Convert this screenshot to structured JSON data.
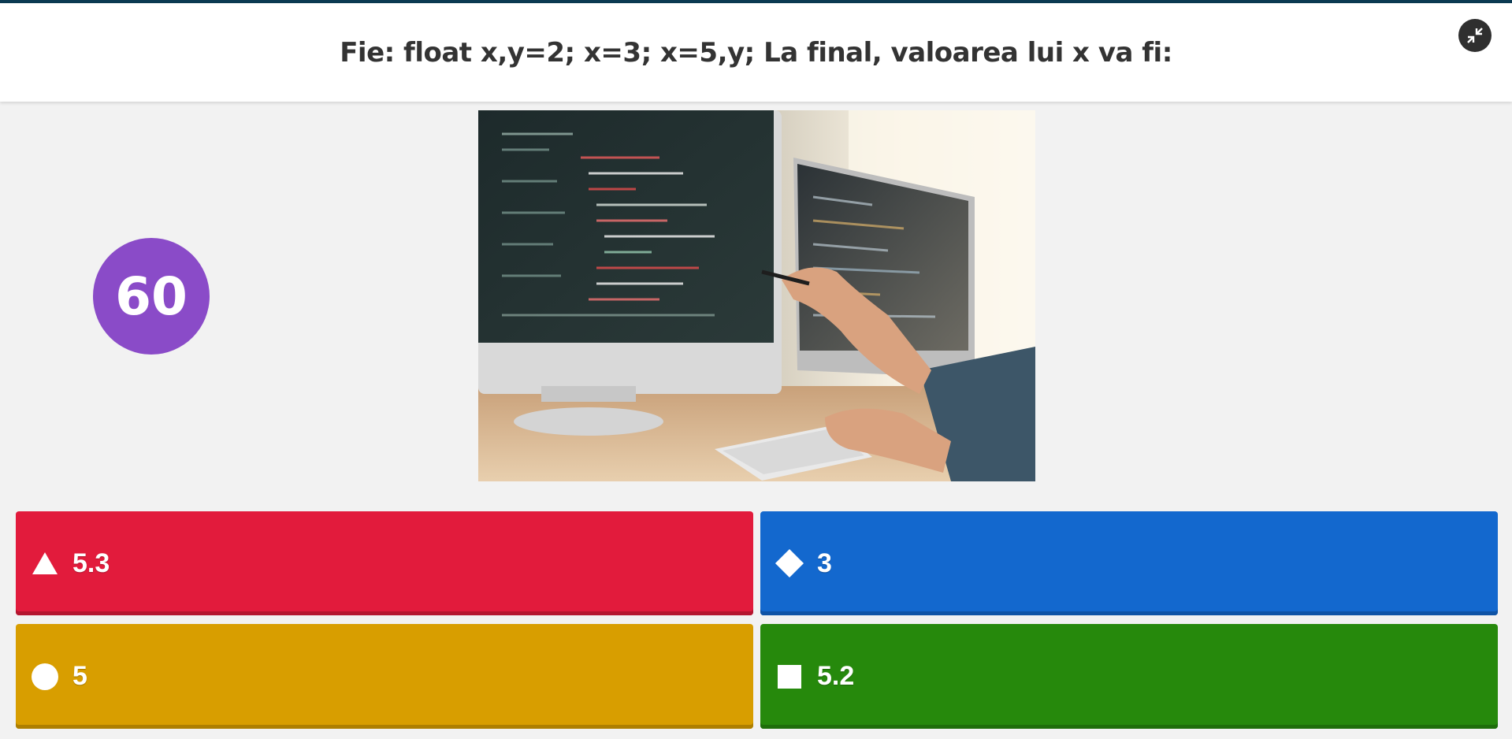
{
  "question": {
    "text": "Fie: float x,y=2; x=3; x=5,y; La final, valoarea lui x va fi:"
  },
  "header": {
    "fullscreen_icon": "fullscreen-exit-icon"
  },
  "timer": {
    "value": "60",
    "color": "#8a4bc8"
  },
  "media": {
    "description_icon": "code-monitors-photo"
  },
  "answers": [
    {
      "label": "5.3",
      "shape": "triangle-icon",
      "color": "#e21b3c",
      "shade": "#b4162f"
    },
    {
      "label": "3",
      "shape": "diamond-icon",
      "color": "#1368ce",
      "shade": "#0f53a5"
    },
    {
      "label": "5",
      "shape": "circle-icon",
      "color": "#d89e00",
      "shade": "#ae7f00"
    },
    {
      "label": "5.2",
      "shape": "square-icon",
      "color": "#26890c",
      "shade": "#1e6e0a"
    }
  ]
}
